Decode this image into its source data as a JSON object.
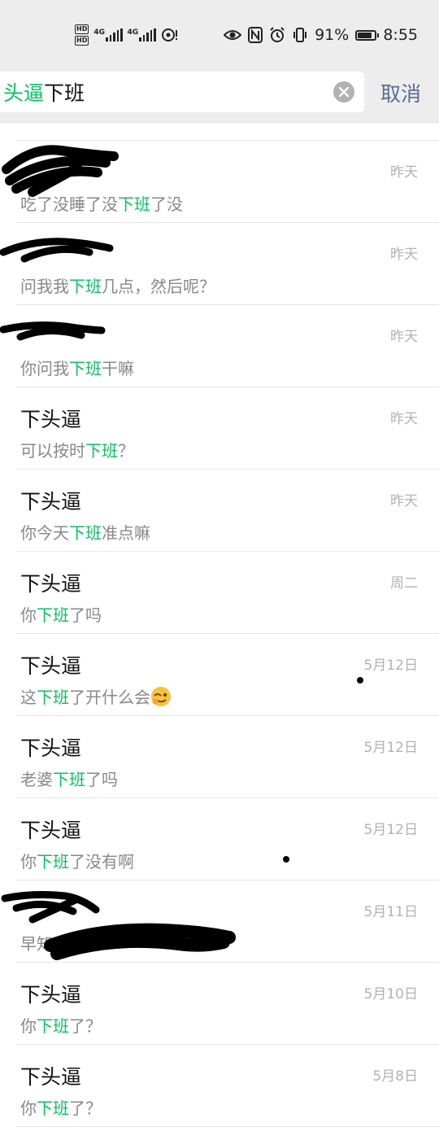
{
  "status_bar": {
    "hd_1": "HD",
    "hd_2": "HD",
    "sim1_tag": "4G",
    "sim2_tag": "4G",
    "battery": "91%",
    "battery_level": 0.91,
    "time": "8:55"
  },
  "search": {
    "query_prefix": "头逼",
    "query_rest": "下班",
    "cancel_label": "取消"
  },
  "results": [
    {
      "name": "",
      "time": "昨天",
      "pre": "吃了没睡了没",
      "hl": "下班",
      "post": "了没"
    },
    {
      "name": "",
      "time": "昨天",
      "pre": "问我我",
      "hl": "下班",
      "post": "几点，然后呢？"
    },
    {
      "name": "",
      "time": "昨天",
      "pre": "你问我",
      "hl": "下班",
      "post": "干嘛"
    },
    {
      "name": "下头逼",
      "time": "昨天",
      "pre": "可以按时",
      "hl": "下班",
      "post": "？"
    },
    {
      "name": "下头逼",
      "time": "昨天",
      "pre": "你今天",
      "hl": "下班",
      "post": "准点嘛"
    },
    {
      "name": "下头逼",
      "time": "周二",
      "pre": "你",
      "hl": "下班",
      "post": "了吗"
    },
    {
      "name": "下头逼",
      "time": "5月12日",
      "pre": "这",
      "hl": "下班",
      "post": "了开什么会"
    },
    {
      "name": "下头逼",
      "time": "5月12日",
      "pre": "老婆",
      "hl": "下班",
      "post": "了吗"
    },
    {
      "name": "下头逼",
      "time": "5月12日",
      "pre": "你",
      "hl": "下班",
      "post": "了没有啊"
    },
    {
      "name": "",
      "time": "5月11日",
      "pre": "早知",
      "hl": "",
      "post": "了"
    },
    {
      "name": "下头逼",
      "time": "5月10日",
      "pre": "你",
      "hl": "下班",
      "post": "了？"
    },
    {
      "name": "下头逼",
      "time": "5月8日",
      "pre": "你",
      "hl": "下班",
      "post": "了？"
    }
  ]
}
